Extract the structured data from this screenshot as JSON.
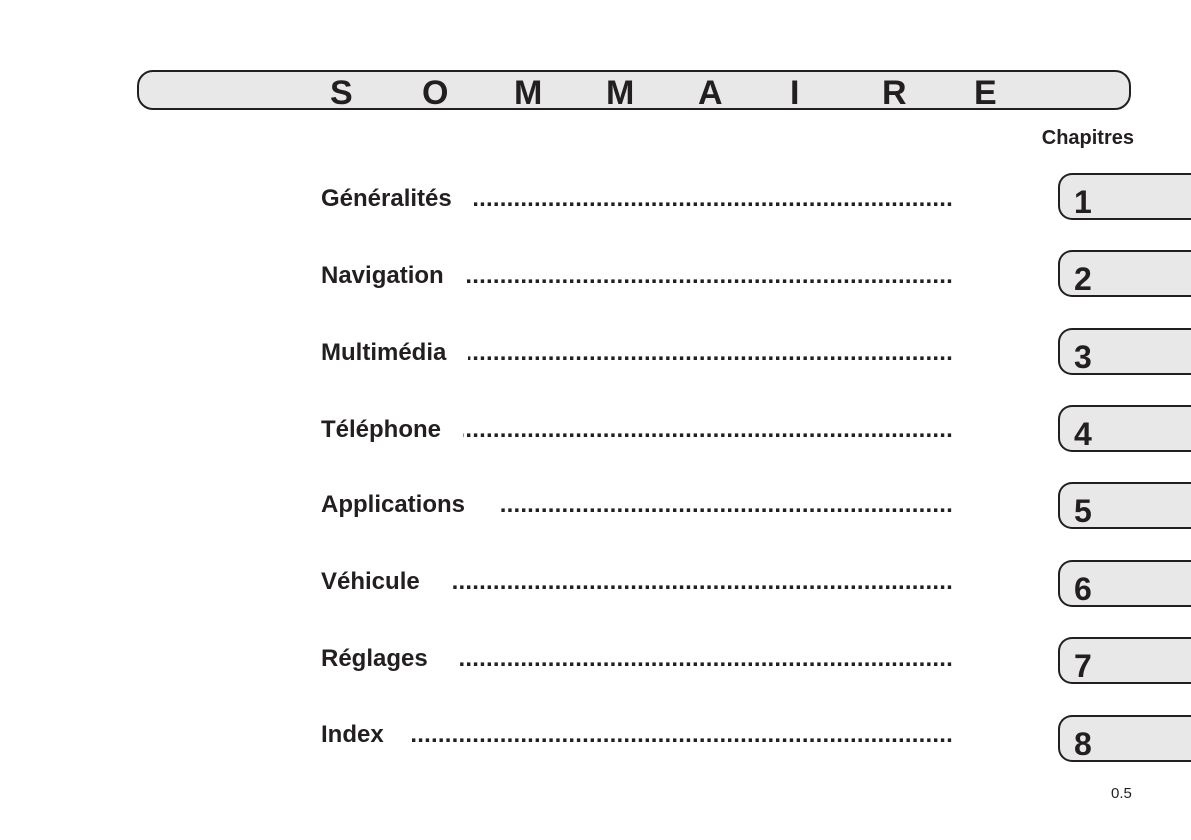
{
  "title": {
    "letters": [
      "S",
      "O",
      "M",
      "M",
      "A",
      "I",
      "R",
      "E"
    ]
  },
  "chapters_label": "Chapitres",
  "entries": [
    {
      "label": "Généralités",
      "chapter": "1"
    },
    {
      "label": "Navigation",
      "chapter": "2"
    },
    {
      "label": "Multimédia",
      "chapter": "3"
    },
    {
      "label": "Téléphone",
      "chapter": "4"
    },
    {
      "label": "Applications",
      "chapter": "5"
    },
    {
      "label": "Véhicule",
      "chapter": "6"
    },
    {
      "label": "Réglages",
      "chapter": "7"
    },
    {
      "label": "Index",
      "chapter": "8"
    }
  ],
  "dots": "................................................................................................",
  "page_number": "0.5"
}
